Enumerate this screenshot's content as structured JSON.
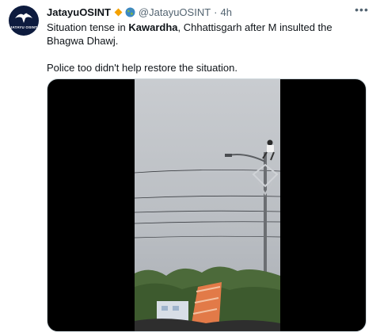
{
  "tweet": {
    "avatar_text": "JATAYU OSINT",
    "display_name": "JatayuOSINT",
    "handle": "@JatayuOSINT",
    "separator": "·",
    "time": "4h",
    "more_icon": "more-horizontal-icon",
    "text": {
      "part1": "Situation tense in ",
      "bold_place": "Kawardha",
      "part2": ", Chhattisgarh after M insulted the Bhagwa Dhawj.",
      "paragraph2": "Police too didn't help restore the situation."
    }
  },
  "colors": {
    "badge_orange": "#f4a100",
    "muted_text": "#536471",
    "avatar_bg": "#0d1b3e"
  }
}
